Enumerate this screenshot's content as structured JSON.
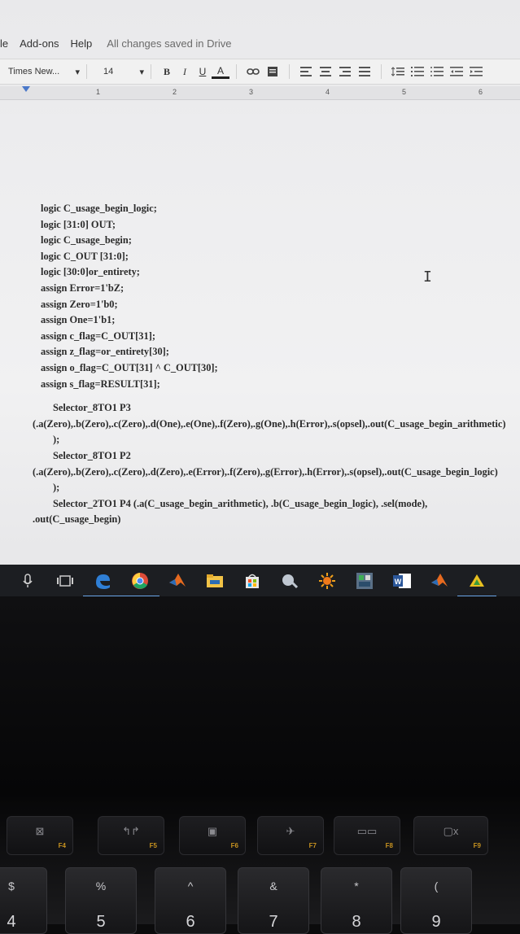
{
  "menubar": {
    "items": [
      "le",
      "Add-ons",
      "Help"
    ],
    "status": "All changes saved in Drive"
  },
  "toolbar": {
    "font": "Times New...",
    "font_caret": "▾",
    "size": "14",
    "size_caret": "▾",
    "bold": "B",
    "italic": "I",
    "underline": "U",
    "text_color": "A"
  },
  "ruler": {
    "numbers": [
      "1",
      "2",
      "3",
      "4",
      "5",
      "6"
    ]
  },
  "document": {
    "lines": [
      "logic C_usage_begin_logic;",
      "logic [31:0] OUT;",
      "logic C_usage_begin;",
      "logic C_OUT [31:0];",
      "logic [30:0]or_entirety;",
      "assign Error=1'bZ;",
      "assign Zero=1'b0;",
      "assign One=1'b1;",
      "assign c_flag=C_OUT[31];",
      "assign z_flag=or_entirety[30];",
      "assign o_flag=C_OUT[31] ^ C_OUT[30];",
      "assign s_flag=RESULT[31];"
    ],
    "inst1_head": "Selector_8TO1 P3",
    "inst1_body": "(.a(Zero),.b(Zero),.c(Zero),.d(One),.e(One),.f(Zero),.g(One),.h(Error),.s(opsel),.out(C_usage_begin_arithmetic)",
    "inst1_close": ");",
    "inst2_head": "Selector_8TO1 P2",
    "inst2_body": "(.a(Zero),.b(Zero),.c(Zero),.d(Zero),.e(Error),.f(Zero),.g(Error),.h(Error),.s(opsel),.out(C_usage_begin_logic)",
    "inst2_close": ");",
    "inst3_head": "Selector_2TO1 P4 (.a(C_usage_begin_arithmetic), .b(C_usage_begin_logic), .sel(mode),",
    "inst3_body": ".out(C_usage_begin)"
  },
  "taskbar": {
    "icons": [
      "microphone-icon",
      "task-view-icon",
      "edge-icon",
      "chrome-icon",
      "matlab-icon",
      "file-explorer-icon",
      "store-icon",
      "snipping-icon",
      "sun-app-icon",
      "photo-app-icon",
      "word-icon",
      "matlab-icon-2",
      "app-icon"
    ],
    "word_label": "W"
  },
  "keyboard": {
    "fkeys": [
      {
        "glyph": "⊠",
        "label": "F4"
      },
      {
        "glyph": "↰↱",
        "label": "F5"
      },
      {
        "glyph": "▣",
        "label": "F6"
      },
      {
        "glyph": "✈",
        "label": "F7"
      },
      {
        "glyph": "▭▭",
        "label": "F8"
      },
      {
        "glyph": "▢x",
        "label": "F9"
      }
    ],
    "numkeys": [
      {
        "top": "$",
        "main": "4"
      },
      {
        "top": "%",
        "main": "5"
      },
      {
        "top": "^",
        "main": "6"
      },
      {
        "top": "&",
        "main": "7"
      },
      {
        "top": "*",
        "main": "8"
      },
      {
        "top": "(",
        "main": "9"
      }
    ]
  },
  "colors": {
    "taskbar": "#1c1e22",
    "accent": "#6aa6e8",
    "fkey_label": "#c89320"
  }
}
